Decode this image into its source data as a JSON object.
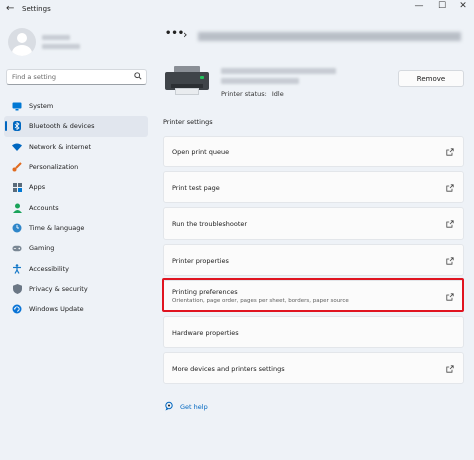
{
  "window": {
    "title": "Settings",
    "back_glyph": "←",
    "minimize_glyph": "—",
    "maximize_glyph": "☐",
    "close_glyph": "✕"
  },
  "search": {
    "placeholder": "Find a setting"
  },
  "sidebar": {
    "items": [
      {
        "label": "System",
        "icon": "monitor-icon",
        "color": "#0078d4"
      },
      {
        "label": "Bluetooth & devices",
        "icon": "bluetooth-icon",
        "color": "#0067c0",
        "active": true
      },
      {
        "label": "Network & internet",
        "icon": "wifi-icon",
        "color": "#0067c0"
      },
      {
        "label": "Personalization",
        "icon": "brush-icon",
        "color": "#e06b20"
      },
      {
        "label": "Apps",
        "icon": "apps-icon",
        "color": "#5a6b7a"
      },
      {
        "label": "Accounts",
        "icon": "person-icon",
        "color": "#1aa35a"
      },
      {
        "label": "Time & language",
        "icon": "globe-clock-icon",
        "color": "#2f86c9"
      },
      {
        "label": "Gaming",
        "icon": "gamepad-icon",
        "color": "#7a8794"
      },
      {
        "label": "Accessibility",
        "icon": "accessibility-icon",
        "color": "#1478c8"
      },
      {
        "label": "Privacy & security",
        "icon": "shield-icon",
        "color": "#6b7785"
      },
      {
        "label": "Windows Update",
        "icon": "update-icon",
        "color": "#0a74d6"
      }
    ]
  },
  "breadcrumb": {
    "overflow": "•••",
    "chevron": "›"
  },
  "printer": {
    "status_label": "Printer status:",
    "status_value": "Idle",
    "remove_label": "Remove"
  },
  "section": {
    "label": "Printer settings"
  },
  "settings": [
    {
      "label": "Open print queue"
    },
    {
      "label": "Print test page"
    },
    {
      "label": "Run the troubleshooter"
    },
    {
      "label": "Printer properties"
    },
    {
      "label": "Printing preferences",
      "description": "Orientation, page order, pages per sheet, borders, paper source"
    },
    {
      "label": "Hardware properties"
    },
    {
      "label": "More devices and printers settings"
    }
  ],
  "help": {
    "label": "Get help"
  },
  "colors": {
    "accent": "#0067c0",
    "highlight": "#e01420",
    "background": "#eef2f7"
  }
}
